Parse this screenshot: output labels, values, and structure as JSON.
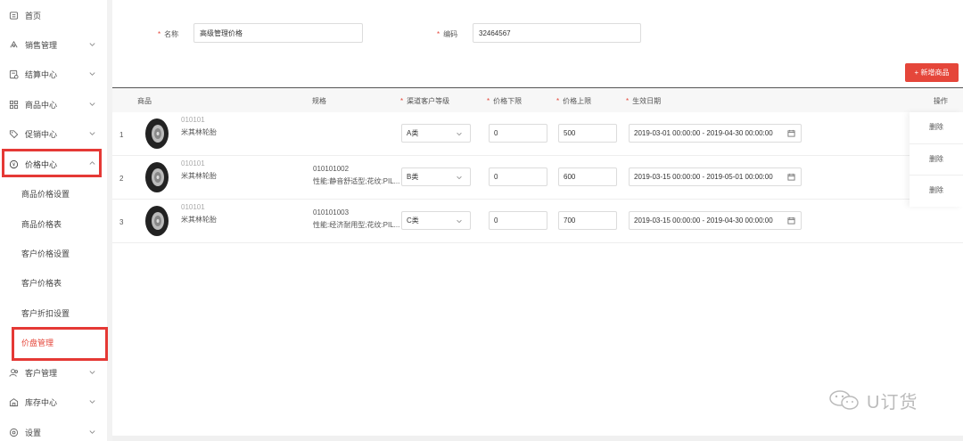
{
  "sidebar": {
    "items": [
      {
        "label": "首页",
        "icon": "home-icon"
      },
      {
        "label": "销售管理",
        "icon": "sales-icon"
      },
      {
        "label": "结算中心",
        "icon": "settlement-icon"
      },
      {
        "label": "商品中心",
        "icon": "grid-icon"
      },
      {
        "label": "促销中心",
        "icon": "tag-icon"
      },
      {
        "label": "价格中心",
        "icon": "price-icon"
      },
      {
        "label": "客户管理",
        "icon": "user-group-icon"
      },
      {
        "label": "库存中心",
        "icon": "warehouse-icon"
      },
      {
        "label": "设置",
        "icon": "gear-icon"
      }
    ],
    "price_sub": [
      {
        "label": "商品价格设置"
      },
      {
        "label": "商品价格表"
      },
      {
        "label": "客户价格设置"
      },
      {
        "label": "客户价格表"
      },
      {
        "label": "客户折扣设置"
      },
      {
        "label": "价盘管理"
      }
    ]
  },
  "form": {
    "required_mark": "*",
    "name_label": "名称",
    "name_value": "高级管理价格",
    "code_label": "编码",
    "code_value": "32464567"
  },
  "toolbar": {
    "add_label": "+ 新增商品"
  },
  "table": {
    "columns": {
      "product": "商品",
      "spec": "规格",
      "channel_level": "渠道客户等级",
      "price_min": "价格下限",
      "price_max": "价格上限",
      "effective_date": "生效日期",
      "action": "操作"
    },
    "rows": [
      {
        "index": "1",
        "code": "010101",
        "name": "米其林轮胎",
        "spec_code": "",
        "spec_desc": "",
        "level": "A类",
        "min": "0",
        "max": "500",
        "date": "2019-03-01 00:00:00 - 2019-04-30 00:00:00",
        "action": "删除"
      },
      {
        "index": "2",
        "code": "010101",
        "name": "米其林轮胎",
        "spec_code": "010101002",
        "spec_desc": "性能:静音舒适型;花纹:PIL...",
        "level": "B类",
        "min": "0",
        "max": "600",
        "date": "2019-03-15 00:00:00 - 2019-05-01 00:00:00",
        "action": "删除"
      },
      {
        "index": "3",
        "code": "010101",
        "name": "米其林轮胎",
        "spec_code": "010101003",
        "spec_desc": "性能:经济耐用型;花纹:PIL...",
        "level": "C类",
        "min": "0",
        "max": "700",
        "date": "2019-03-15 00:00:00 - 2019-04-30 00:00:00",
        "action": "删除"
      }
    ]
  },
  "watermark": {
    "text": "U订货"
  },
  "colors": {
    "accent": "#e5463a",
    "highlight_box": "#e53935"
  }
}
